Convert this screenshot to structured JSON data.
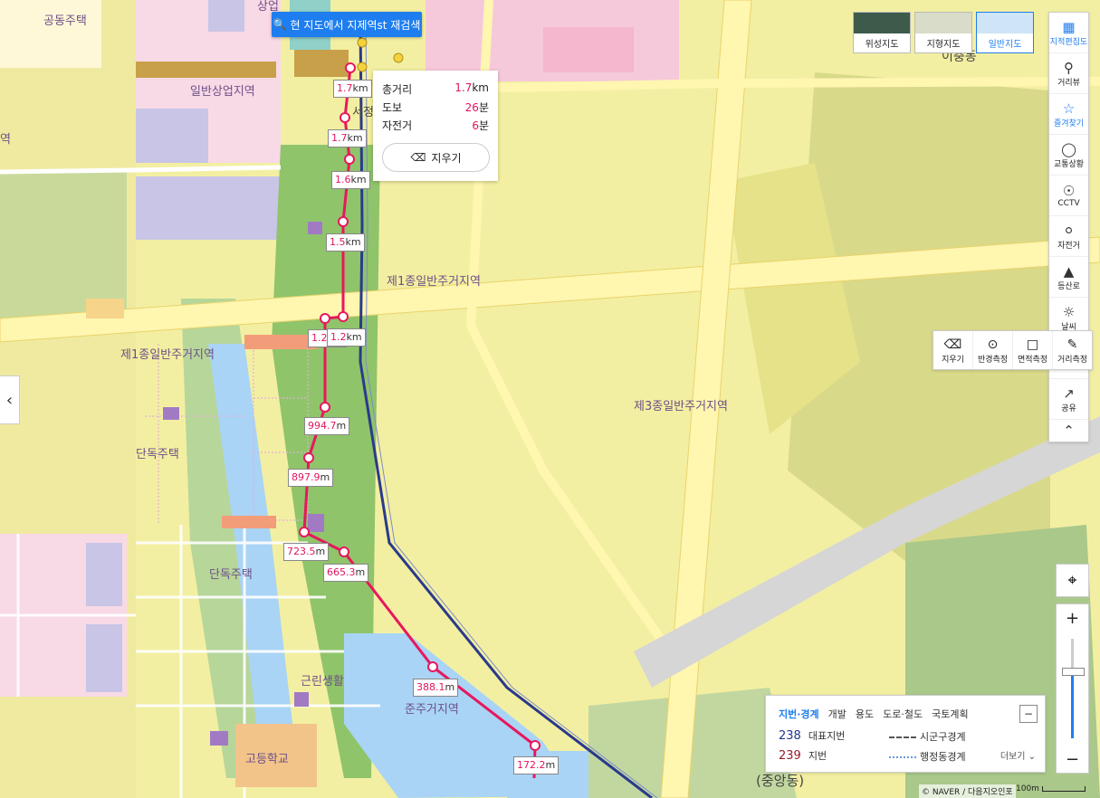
{
  "search_button": {
    "label": "현 지도에서 지제역st 재검색"
  },
  "route_info": {
    "total_label": "총거리",
    "total_value": "1.7",
    "total_unit": "km",
    "walk_label": "도보",
    "walk_value": "26",
    "walk_unit": "분",
    "bike_label": "자전거",
    "bike_value": "6",
    "bike_unit": "분",
    "clear_label": "지우기"
  },
  "map_types": [
    {
      "label": "위성지도",
      "active": false
    },
    {
      "label": "지형지도",
      "active": false
    },
    {
      "label": "일반지도",
      "active": true
    }
  ],
  "toolbar": [
    {
      "label": "지적편집도",
      "icon": "layers-icon",
      "active": true
    },
    {
      "label": "거리뷰",
      "icon": "pin-icon",
      "active": false
    },
    {
      "label": "즐겨찾기",
      "icon": "star-icon",
      "active": true
    },
    {
      "label": "교통상황",
      "icon": "traffic-light-icon",
      "active": false
    },
    {
      "label": "CCTV",
      "icon": "cctv-icon",
      "active": false
    },
    {
      "label": "자전거",
      "icon": "bicycle-icon",
      "active": false
    },
    {
      "label": "등산로",
      "icon": "mountain-icon",
      "active": false
    },
    {
      "label": "날씨",
      "icon": "sun-icon",
      "active": false
    },
    {
      "label": "",
      "icon": "",
      "active": false
    },
    {
      "label": "공유",
      "icon": "share-icon",
      "active": false
    }
  ],
  "measure_tools": [
    {
      "label": "지우기",
      "icon": "eraser-icon"
    },
    {
      "label": "반경측정",
      "icon": "radius-icon"
    },
    {
      "label": "면적측정",
      "icon": "area-icon"
    },
    {
      "label": "거리측정",
      "icon": "ruler-icon"
    }
  ],
  "zone_labels": [
    {
      "text": "공동주택"
    },
    {
      "text": "일반상업지역"
    },
    {
      "text": "역"
    },
    {
      "text": "상업"
    },
    {
      "text": "제1종일반주거지역"
    },
    {
      "text": "제1종일반주거지역"
    },
    {
      "text": "단독주택"
    },
    {
      "text": "단독주택"
    },
    {
      "text": "제3종일반주거지역"
    },
    {
      "text": "근린생활"
    },
    {
      "text": "준주거지역"
    },
    {
      "text": "고등학교"
    },
    {
      "text": "이충동"
    },
    {
      "text": "(중앙동)"
    },
    {
      "text": "서정"
    }
  ],
  "distance_labels": [
    {
      "value": "1.7",
      "unit": "km"
    },
    {
      "value": "1.7",
      "unit": "km"
    },
    {
      "value": "1.6",
      "unit": "km"
    },
    {
      "value": "1.5",
      "unit": "km"
    },
    {
      "value": "1.2",
      "unit": "km"
    },
    {
      "value": "1.2",
      "unit": "km"
    },
    {
      "value": "994.7",
      "unit": "m"
    },
    {
      "value": "897.9",
      "unit": "m"
    },
    {
      "value": "723.5",
      "unit": "m"
    },
    {
      "value": "665.3",
      "unit": "m"
    },
    {
      "value": "388.1",
      "unit": "m"
    },
    {
      "value": "172.2",
      "unit": "m"
    }
  ],
  "legend": {
    "tabs": [
      "지번·경계",
      "개발",
      "용도",
      "도로·철도",
      "국토계획"
    ],
    "active_tab": 0,
    "row1_num": "238",
    "row1_label": "대표지번",
    "row2_num": "239",
    "row2_label": "지번",
    "row1_line": "시군구경계",
    "row2_line": "행정동경계",
    "more": "더보기"
  },
  "copyright": "© NAVER / 다음지오인포",
  "scale": "100m",
  "colors": {
    "route": "#e8175d",
    "rail": "#2a3a8c",
    "accent": "#1e7ef0",
    "residential": "#f3ef8e",
    "park": "#8fc46a",
    "water": "#a9d4f5"
  }
}
